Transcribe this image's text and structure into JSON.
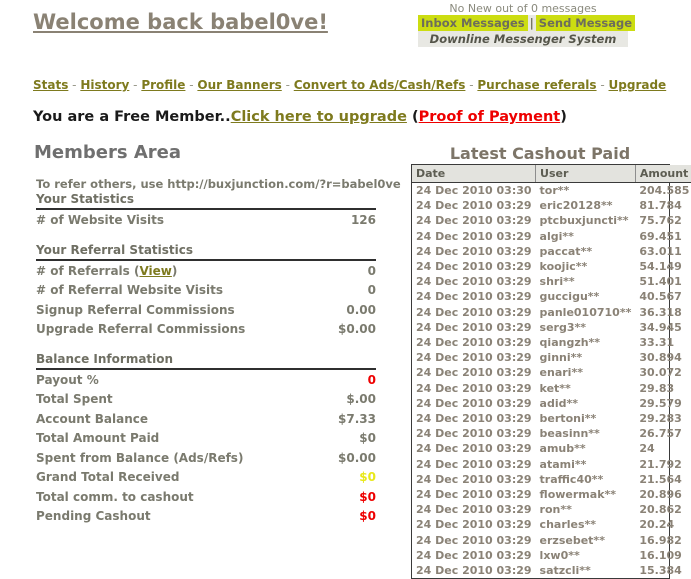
{
  "messenger": {
    "status": "No New out of 0 messages",
    "inbox_label": "Inbox Messages",
    "separator": "|",
    "send_label": "Send Message",
    "caption": "Downline Messenger System",
    "highlight_color": "#ccdd11",
    "panel_bg": "#e8e8e3"
  },
  "header": {
    "welcome_title": "Welcome back babel0ve!"
  },
  "nav": {
    "items": [
      {
        "label": "Stats"
      },
      {
        "label": "History"
      },
      {
        "label": "Profile"
      },
      {
        "label": "Our Banners"
      },
      {
        "label": "Convert to Ads/Cash/Refs"
      },
      {
        "label": "Purchase referals"
      },
      {
        "label": "Upgrade"
      }
    ],
    "separator": "-",
    "link_color": "#7e7a1e"
  },
  "member_status": {
    "text": "You are a Free Member..",
    "upgrade_link": "Click here to upgrade",
    "open_paren": " (",
    "proof_link": "Proof of Payment",
    "close_paren": ")",
    "proof_color": "#ee0000"
  },
  "main": {
    "heading": "Members Area",
    "referral_line": "To refer others, use http://buxjunction.com/?r=babel0ve"
  },
  "stats": {
    "your_statistics": {
      "heading": "Your Statistics",
      "rows": [
        {
          "label": "# of Website Visits",
          "value": "126",
          "color": ""
        }
      ]
    },
    "referral_statistics": {
      "heading": "Your Referral Statistics",
      "rows": [
        {
          "label": "# of Referrals (",
          "link": "View",
          "label_tail": ")",
          "value": "0",
          "color": ""
        },
        {
          "label": "# of Referral Website Visits",
          "value": "0",
          "color": ""
        },
        {
          "label": "Signup Referral Commissions",
          "value": "0.00",
          "color": ""
        },
        {
          "label": "Upgrade Referral Commissions",
          "value": "$0.00",
          "color": ""
        }
      ]
    },
    "balance_information": {
      "heading": "Balance Information",
      "rows": [
        {
          "label": "Payout %",
          "value": "0",
          "color": "red"
        },
        {
          "label": "Total Spent",
          "value": "$.00",
          "color": ""
        },
        {
          "label": "Account Balance",
          "value": "$7.33",
          "color": ""
        },
        {
          "label": "Total Amount Paid",
          "value": "$0",
          "color": ""
        },
        {
          "label": "Spent from Balance (Ads/Refs)",
          "value": "$0.00",
          "color": ""
        },
        {
          "label": "Grand Total Received",
          "value": "$0",
          "color": "yellow"
        },
        {
          "label": "Total comm. to cashout",
          "value": "$0",
          "color": "red"
        },
        {
          "label": "Pending Cashout",
          "value": "$0",
          "color": "red"
        }
      ]
    }
  },
  "cashout": {
    "title": "Latest Cashout Paid",
    "columns": [
      "Date",
      "User",
      "Amount"
    ],
    "rows": [
      [
        "24 Dec 2010 03:30",
        "tor**",
        "204.585"
      ],
      [
        "24 Dec 2010 03:29",
        "eric20128**",
        "81.784"
      ],
      [
        "24 Dec 2010 03:29",
        "ptcbuxjuncti**",
        "75.762"
      ],
      [
        "24 Dec 2010 03:29",
        "algi**",
        "69.451"
      ],
      [
        "24 Dec 2010 03:29",
        "paccat**",
        "63.011"
      ],
      [
        "24 Dec 2010 03:29",
        "koojic**",
        "54.149"
      ],
      [
        "24 Dec 2010 03:29",
        "shri**",
        "51.401"
      ],
      [
        "24 Dec 2010 03:29",
        "guccigu**",
        "40.567"
      ],
      [
        "24 Dec 2010 03:29",
        "panle010710**",
        "36.318"
      ],
      [
        "24 Dec 2010 03:29",
        "serg3**",
        "34.945"
      ],
      [
        "24 Dec 2010 03:29",
        "qiangzh**",
        "33.31"
      ],
      [
        "24 Dec 2010 03:29",
        "ginni**",
        "30.894"
      ],
      [
        "24 Dec 2010 03:29",
        "enari**",
        "30.072"
      ],
      [
        "24 Dec 2010 03:29",
        "ket**",
        "29.83"
      ],
      [
        "24 Dec 2010 03:29",
        "adid**",
        "29.579"
      ],
      [
        "24 Dec 2010 03:29",
        "bertoni**",
        "29.283"
      ],
      [
        "24 Dec 2010 03:29",
        "beasinn**",
        "26.757"
      ],
      [
        "24 Dec 2010 03:29",
        "amub**",
        "24"
      ],
      [
        "24 Dec 2010 03:29",
        "atami**",
        "21.792"
      ],
      [
        "24 Dec 2010 03:29",
        "traffic40**",
        "21.564"
      ],
      [
        "24 Dec 2010 03:29",
        "flowermak**",
        "20.896"
      ],
      [
        "24 Dec 2010 03:29",
        "ron**",
        "20.862"
      ],
      [
        "24 Dec 2010 03:29",
        "charles**",
        "20.24"
      ],
      [
        "24 Dec 2010 03:29",
        "erzsebet**",
        "16.982"
      ],
      [
        "24 Dec 2010 03:29",
        "lxw0**",
        "16.109"
      ],
      [
        "24 Dec 2010 03:29",
        "satzcli**",
        "15.384"
      ]
    ]
  }
}
